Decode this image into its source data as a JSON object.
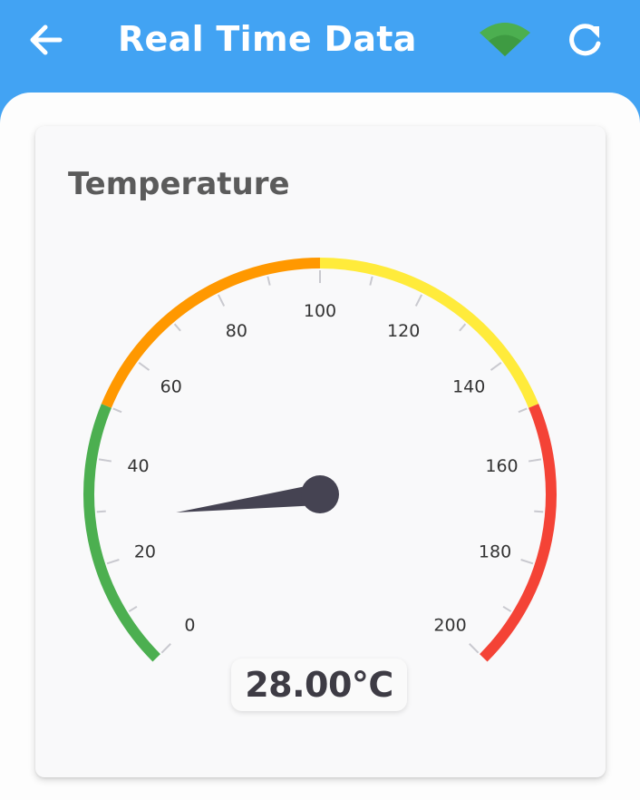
{
  "appbar": {
    "title": "Real Time Data",
    "back_icon": "arrow-back-icon",
    "wifi_icon": "wifi-icon",
    "refresh_icon": "refresh-icon",
    "bar_color": "#42A3F3"
  },
  "card": {
    "title": "Temperature"
  },
  "gauge": {
    "value": 28.0,
    "min": 0,
    "max": 200,
    "unit": "°C",
    "readout": "28.00°C",
    "tick_labels": [
      "0",
      "20",
      "40",
      "60",
      "80",
      "100",
      "120",
      "140",
      "160",
      "180",
      "200"
    ],
    "ranges": [
      {
        "from": 0,
        "to": 50,
        "color": "#4CAF50"
      },
      {
        "from": 50,
        "to": 100,
        "color": "#FF9800"
      },
      {
        "from": 100,
        "to": 150,
        "color": "#FFEB3B"
      },
      {
        "from": 150,
        "to": 200,
        "color": "#F44336"
      }
    ],
    "needle_color": "#454352"
  }
}
